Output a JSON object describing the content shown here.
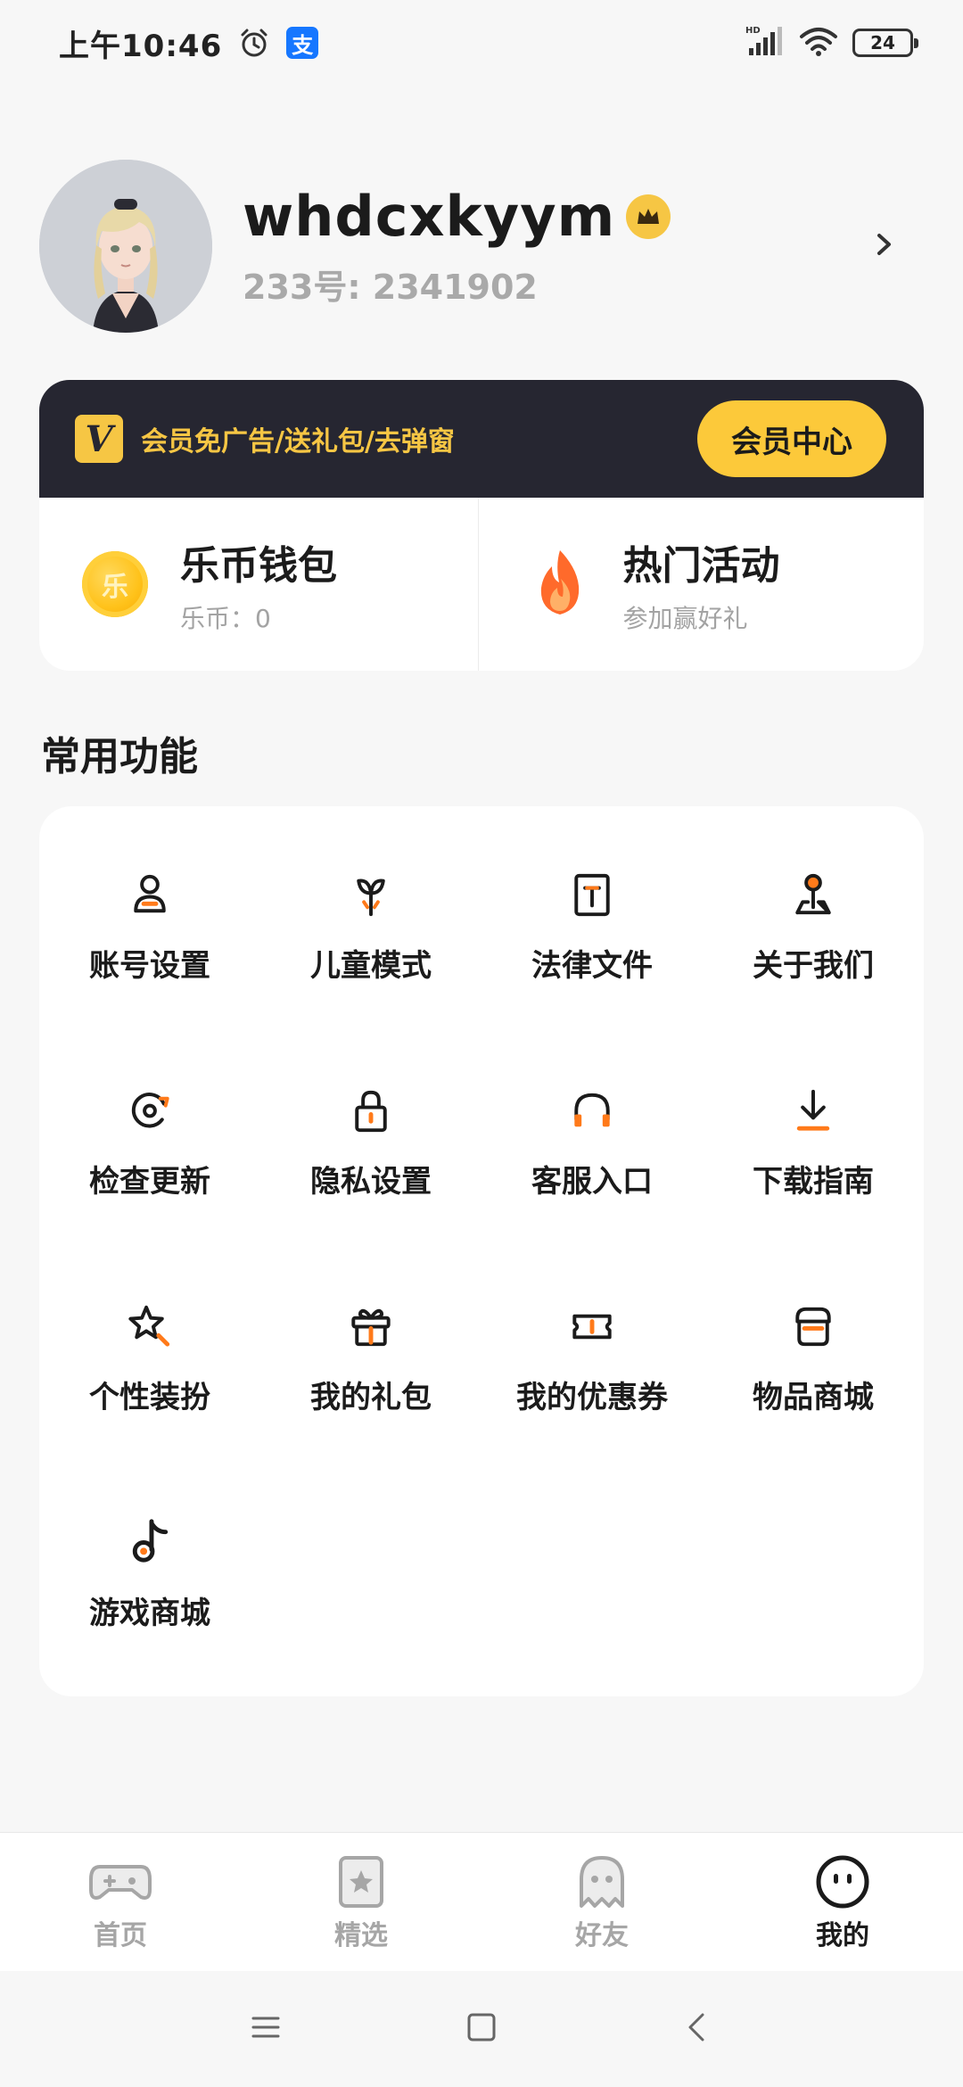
{
  "status_bar": {
    "time": "上午10:46",
    "icons": [
      "alarm-icon",
      "alipay-icon",
      "hd-signal-icon",
      "wifi-icon",
      "battery-icon"
    ],
    "alipay_glyph": "支",
    "battery_level": "24"
  },
  "profile": {
    "username": "whdcxkyym",
    "user_id": "233号: 2341902",
    "badge_icon": "crown-icon"
  },
  "vip": {
    "logo_letter": "V",
    "promo_text": "会员免广告/送礼包/去弹窗",
    "button_label": "会员中心"
  },
  "wallet": {
    "title": "乐币钱包",
    "subtitle": "乐币：0",
    "coin_glyph": "乐"
  },
  "activity": {
    "title": "热门活动",
    "subtitle": "参加赢好礼"
  },
  "functions": {
    "section_title": "常用功能",
    "items": [
      {
        "label": "账号设置",
        "icon": "user-icon"
      },
      {
        "label": "儿童模式",
        "icon": "sprout-icon"
      },
      {
        "label": "法律文件",
        "icon": "document-icon"
      },
      {
        "label": "关于我们",
        "icon": "location-pin-icon"
      },
      {
        "label": "检查更新",
        "icon": "refresh-icon"
      },
      {
        "label": "隐私设置",
        "icon": "lock-icon"
      },
      {
        "label": "客服入口",
        "icon": "headphones-icon"
      },
      {
        "label": "下载指南",
        "icon": "download-icon"
      },
      {
        "label": "个性装扮",
        "icon": "star-wand-icon"
      },
      {
        "label": "我的礼包",
        "icon": "gift-icon"
      },
      {
        "label": "我的优惠券",
        "icon": "coupon-icon"
      },
      {
        "label": "物品商城",
        "icon": "store-icon"
      },
      {
        "label": "游戏商城",
        "icon": "music-note-icon"
      }
    ]
  },
  "bottom_nav": {
    "items": [
      {
        "label": "首页",
        "icon": "gamepad-icon"
      },
      {
        "label": "精选",
        "icon": "star-badge-icon"
      },
      {
        "label": "好友",
        "icon": "ghost-icon"
      },
      {
        "label": "我的",
        "icon": "smiley-icon"
      }
    ],
    "active": "我的"
  },
  "colors": {
    "accent_orange": "#ff7a1a",
    "vip_gold": "#f6c644",
    "vip_dark": "#262631",
    "background": "#f7f7f7"
  }
}
